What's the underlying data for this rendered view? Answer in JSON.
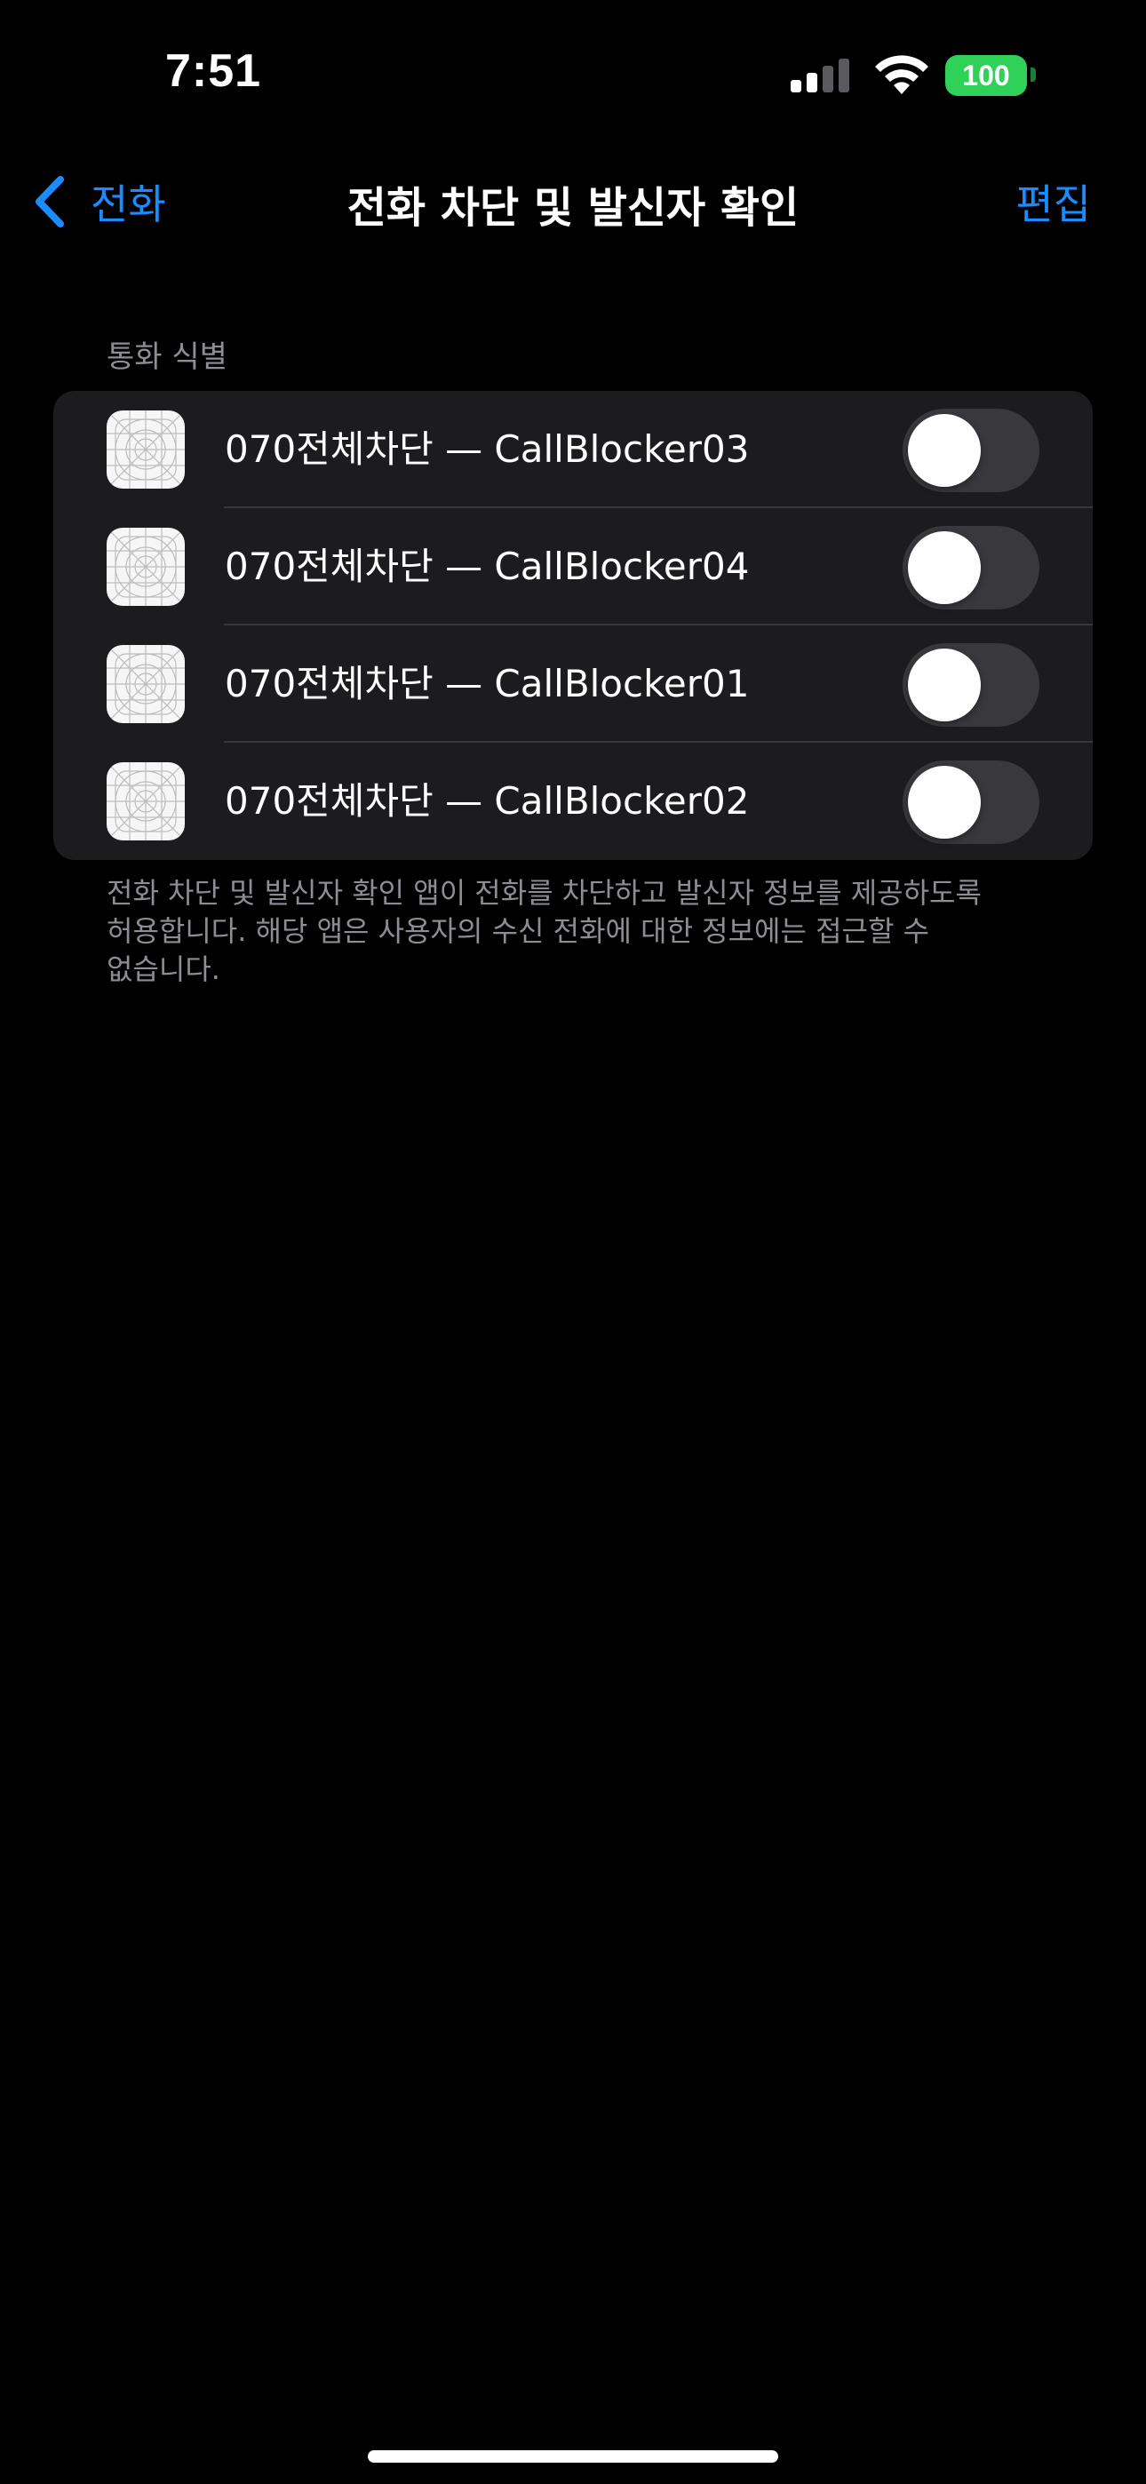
{
  "status_bar": {
    "time": "7:51",
    "battery": "100",
    "signal_icon": "cellular-signal-icon",
    "wifi_icon": "wifi-icon",
    "battery_color": "#30d158"
  },
  "nav": {
    "back_label": "전화",
    "title": "전화 차단 및 발신자 확인",
    "edit_label": "편집",
    "accent_color": "#1a8cff"
  },
  "section": {
    "header": "통화 식별",
    "footer": "전화 차단 및 발신자 확인 앱이 전화를 차단하고 발신자 정보를 제공하도록 허용합니다. 해당 앱은 사용자의 수신 전화에 대한 정보에는 접근할 수 없습니다.",
    "items": [
      {
        "label": "070전체차단 — CallBlocker03",
        "enabled": false
      },
      {
        "label": "070전체차단 — CallBlocker04",
        "enabled": false
      },
      {
        "label": "070전체차단 — CallBlocker01",
        "enabled": false
      },
      {
        "label": "070전체차단 — CallBlocker02",
        "enabled": false
      }
    ]
  }
}
